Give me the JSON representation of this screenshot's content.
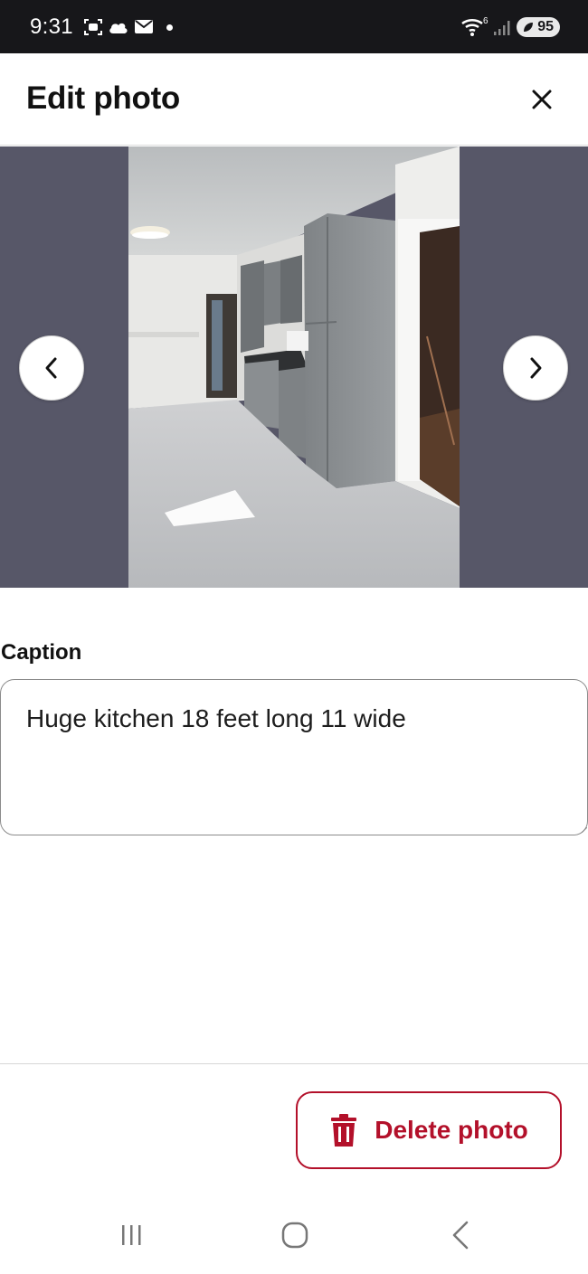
{
  "status_bar": {
    "time": "9:31",
    "battery": "95",
    "signal_label": "6",
    "icons": [
      "screenshot-icon",
      "cloud-icon",
      "mail-icon",
      "notification-dot-icon",
      "wifi-icon",
      "signal-icon",
      "battery-saver-icon"
    ]
  },
  "header": {
    "title": "Edit photo",
    "close_icon": "close-icon"
  },
  "viewer": {
    "prev_icon": "chevron-left-icon",
    "next_icon": "chevron-right-icon",
    "background": "#575768"
  },
  "caption": {
    "label": "Caption",
    "value": "Huge kitchen 18 feet long 11 wide"
  },
  "footer": {
    "delete_label": "Delete photo",
    "delete_icon": "trash-icon",
    "accent_color": "#b3102a"
  },
  "android_nav": {
    "icons": [
      "recents-icon",
      "home-icon",
      "back-icon"
    ]
  }
}
